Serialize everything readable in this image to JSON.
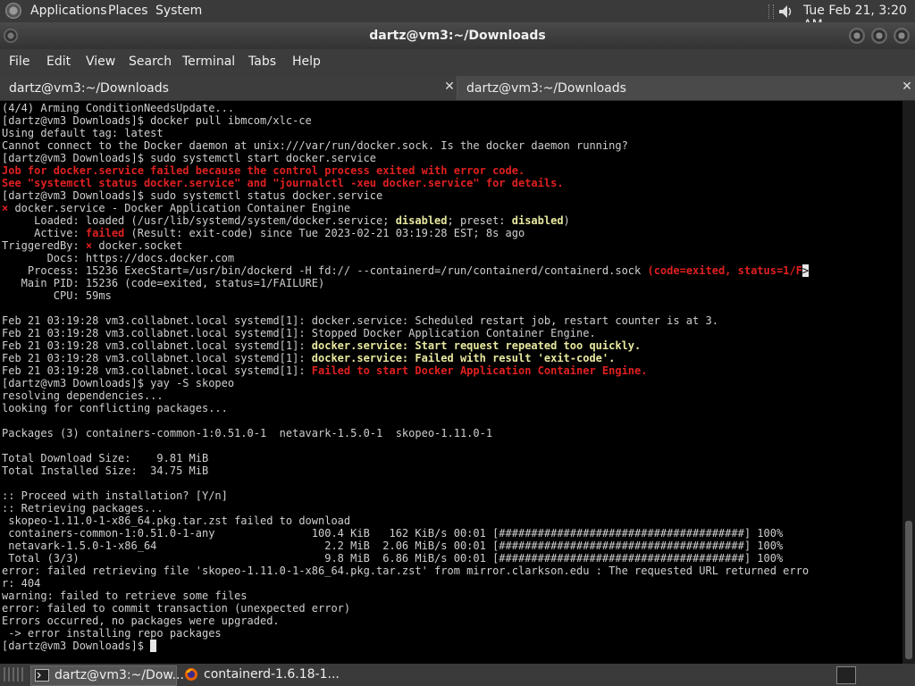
{
  "top_panel": {
    "menus": [
      "Applications",
      "Places",
      "System"
    ],
    "clock": "Tue Feb 21,  3:20 AM"
  },
  "window": {
    "title": "dartz@vm3:~/Downloads"
  },
  "menubar": {
    "items": [
      "File",
      "Edit",
      "View",
      "Search",
      "Terminal",
      "Tabs",
      "Help"
    ]
  },
  "tabs": [
    {
      "label": "dartz@vm3:~/Downloads"
    },
    {
      "label": "dartz@vm3:~/Downloads"
    }
  ],
  "close_glyph": "✕",
  "terminal": {
    "lines": [
      [
        {
          "t": "(4/4) Arming ConditionNeedsUpdate..."
        }
      ],
      [
        {
          "t": "[dartz@vm3 Downloads]$ docker pull ibmcom/xlc-ce"
        }
      ],
      [
        {
          "t": "Using default tag: latest"
        }
      ],
      [
        {
          "t": "Cannot connect to the Docker daemon at unix:///var/run/docker.sock. Is the docker daemon running?"
        }
      ],
      [
        {
          "t": "[dartz@vm3 Downloads]$ sudo systemctl start docker.service"
        }
      ],
      [
        {
          "t": "Job for docker.service failed because the control process exited with error code.",
          "c": "red"
        }
      ],
      [
        {
          "t": "See \"systemctl status docker.service\" and \"journalctl -xeu docker.service\" for details.",
          "c": "red"
        }
      ],
      [
        {
          "t": "[dartz@vm3 Downloads]$ sudo systemctl status docker.service"
        }
      ],
      [
        {
          "t": "×",
          "c": "red"
        },
        {
          "t": " docker.service - Docker Application Container Engine"
        }
      ],
      [
        {
          "t": "     Loaded: loaded (/usr/lib/systemd/system/docker.service; "
        },
        {
          "t": "disabled",
          "c": "yellow"
        },
        {
          "t": "; preset: "
        },
        {
          "t": "disabled",
          "c": "yellow"
        },
        {
          "t": ")"
        }
      ],
      [
        {
          "t": "     Active: "
        },
        {
          "t": "failed",
          "c": "red"
        },
        {
          "t": " (Result: exit-code) since Tue 2023-02-21 03:19:28 EST; 8s ago"
        }
      ],
      [
        {
          "t": "TriggeredBy: "
        },
        {
          "t": "×",
          "c": "red"
        },
        {
          "t": " docker.socket"
        }
      ],
      [
        {
          "t": "       Docs: https://docs.docker.com"
        }
      ],
      [
        {
          "t": "    Process: 15236 ExecStart=/usr/bin/dockerd -H fd:// --containerd=/run/containerd/containerd.sock "
        },
        {
          "t": "(code=exited, status=1/F",
          "c": "red"
        },
        {
          "t": ">",
          "c": "cursor"
        }
      ],
      [
        {
          "t": "   Main PID: 15236 (code=exited, status=1/FAILURE)"
        }
      ],
      [
        {
          "t": "        CPU: 59ms"
        }
      ],
      [
        {
          "t": ""
        }
      ],
      [
        {
          "t": "Feb 21 03:19:28 vm3.collabnet.local systemd[1]: docker.service: Scheduled restart job, restart counter is at 3."
        }
      ],
      [
        {
          "t": "Feb 21 03:19:28 vm3.collabnet.local systemd[1]: Stopped Docker Application Container Engine."
        }
      ],
      [
        {
          "t": "Feb 21 03:19:28 vm3.collabnet.local systemd[1]: "
        },
        {
          "t": "docker.service: Start request repeated too quickly.",
          "c": "yellow"
        }
      ],
      [
        {
          "t": "Feb 21 03:19:28 vm3.collabnet.local systemd[1]: "
        },
        {
          "t": "docker.service: Failed with result 'exit-code'.",
          "c": "yellow"
        }
      ],
      [
        {
          "t": "Feb 21 03:19:28 vm3.collabnet.local systemd[1]: "
        },
        {
          "t": "Failed to start Docker Application Container Engine.",
          "c": "red"
        }
      ],
      [
        {
          "t": "[dartz@vm3 Downloads]$ yay -S skopeo"
        }
      ],
      [
        {
          "t": "resolving dependencies..."
        }
      ],
      [
        {
          "t": "looking for conflicting packages..."
        }
      ],
      [
        {
          "t": ""
        }
      ],
      [
        {
          "t": "Packages (3) containers-common-1:0.51.0-1  netavark-1.5.0-1  skopeo-1.11.0-1"
        }
      ],
      [
        {
          "t": ""
        }
      ],
      [
        {
          "t": "Total Download Size:    9.81 MiB"
        }
      ],
      [
        {
          "t": "Total Installed Size:  34.75 MiB"
        }
      ],
      [
        {
          "t": ""
        }
      ],
      [
        {
          "t": ":: Proceed with installation? [Y/n]"
        }
      ],
      [
        {
          "t": ":: Retrieving packages..."
        }
      ],
      [
        {
          "t": " skopeo-1.11.0-1-x86_64.pkg.tar.zst failed to download"
        }
      ],
      [
        {
          "t": " containers-common-1:0.51.0-1-any               100.4 KiB   162 KiB/s 00:01 [######################################] 100%"
        }
      ],
      [
        {
          "t": " netavark-1.5.0-1-x86_64                          2.2 MiB  2.06 MiB/s 00:01 [######################################] 100%"
        }
      ],
      [
        {
          "t": " Total (3/3)                                      9.8 MiB  6.86 MiB/s 00:01 [######################################] 100%"
        }
      ],
      [
        {
          "t": "error: failed retrieving file 'skopeo-1.11.0-1-x86_64.pkg.tar.zst' from mirror.clarkson.edu : The requested URL returned erro"
        }
      ],
      [
        {
          "t": "r: 404"
        }
      ],
      [
        {
          "t": "warning: failed to retrieve some files"
        }
      ],
      [
        {
          "t": "error: failed to commit transaction (unexpected error)"
        }
      ],
      [
        {
          "t": "Errors occurred, no packages were upgraded."
        }
      ],
      [
        {
          "t": " -> error installing repo packages"
        }
      ],
      [
        {
          "t": "[dartz@vm3 Downloads]$ "
        },
        {
          "t": " ",
          "c": "cursor"
        }
      ]
    ]
  },
  "taskbar": {
    "items": [
      {
        "label": "dartz@vm3:~/Dow...",
        "icon": "terminal-icon"
      },
      {
        "label": "containerd-1.6.18-1...",
        "icon": "firefox-icon"
      }
    ]
  }
}
